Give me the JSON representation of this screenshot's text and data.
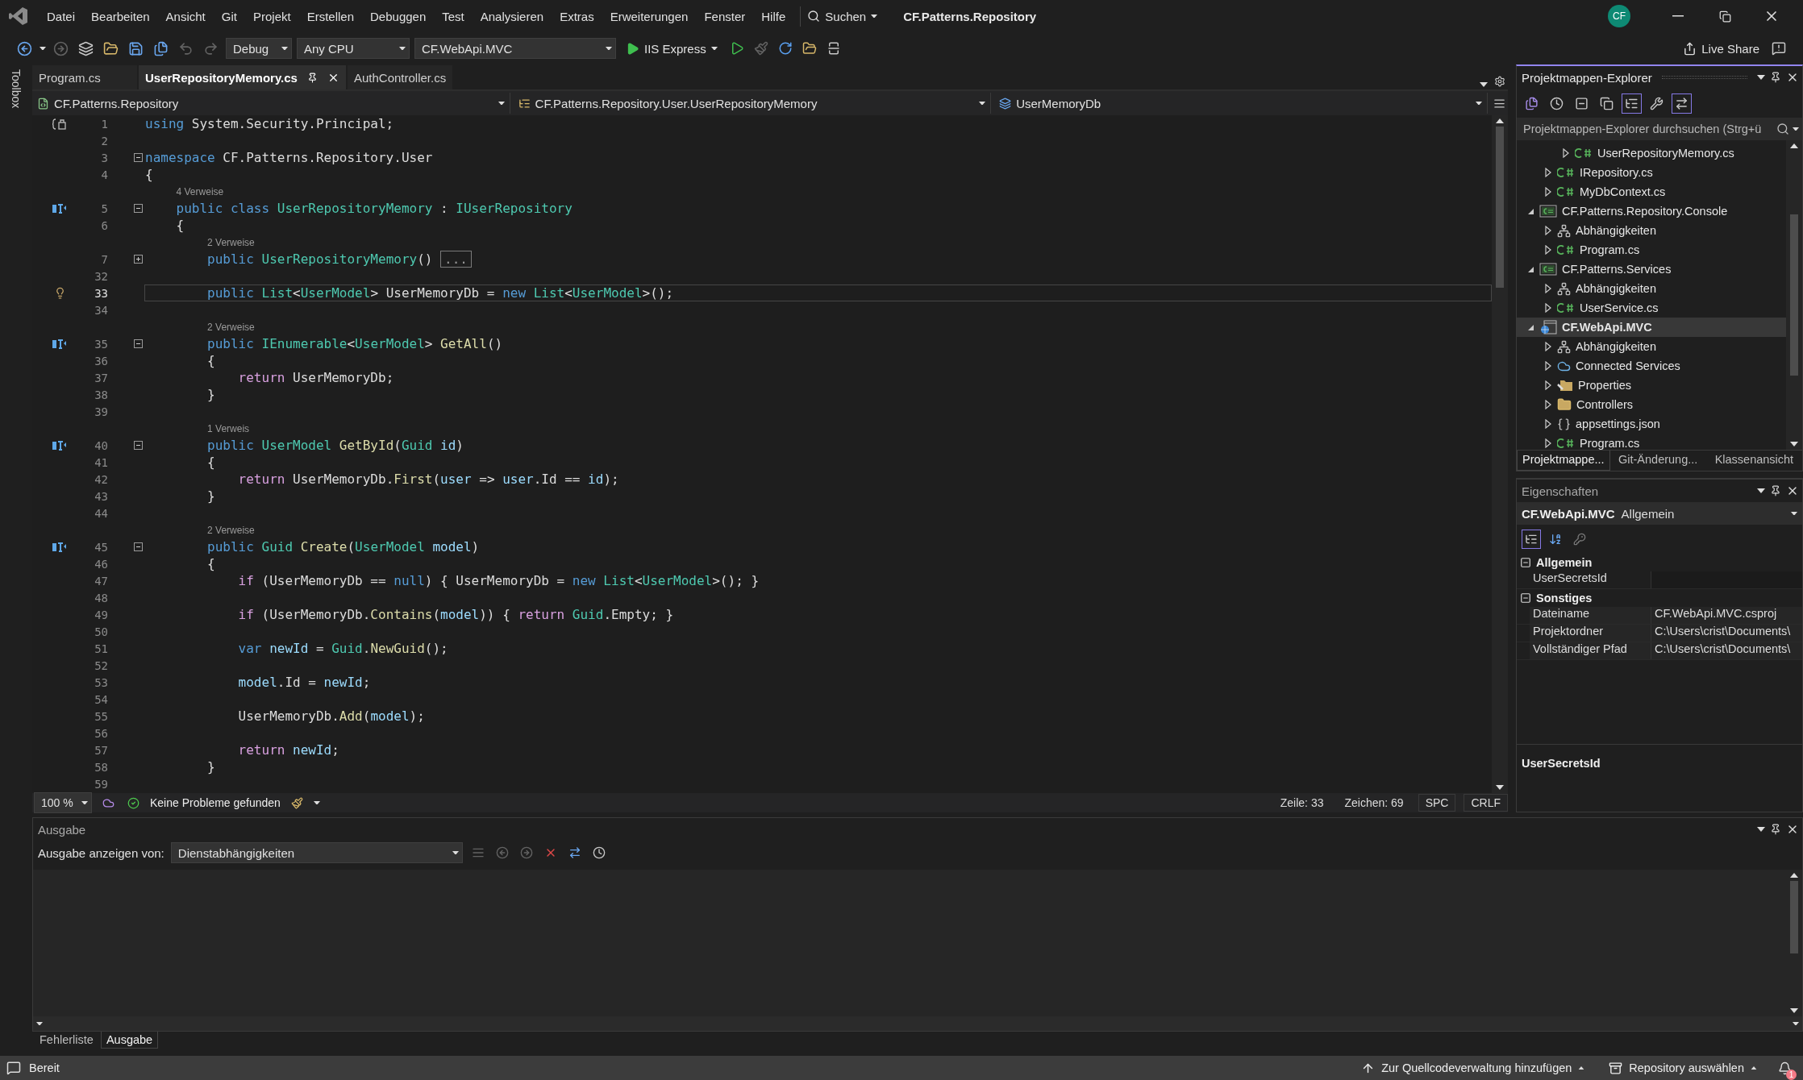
{
  "title_bar": {
    "menu": [
      "Datei",
      "Bearbeiten",
      "Ansicht",
      "Git",
      "Projekt",
      "Erstellen",
      "Debuggen",
      "Test",
      "Analysieren",
      "Extras",
      "Erweiterungen",
      "Fenster",
      "Hilfe"
    ],
    "search": "Suchen",
    "title": "CF.Patterns.Repository",
    "avatar": "CF"
  },
  "toolbar": {
    "dropdowns": [
      "Debug",
      "Any CPU",
      "CF.WebApi.MVC"
    ],
    "run": "IIS Express",
    "live_share": "Live Share"
  },
  "toolbox": "Toolbox",
  "editor": {
    "tabs": [
      {
        "label": "Program.cs",
        "selected": false
      },
      {
        "label": "UserRepositoryMemory.cs",
        "selected": true
      },
      {
        "label": "AuthController.cs",
        "selected": false
      }
    ],
    "nav": [
      "CF.Patterns.Repository",
      "CF.Patterns.Repository.User.UserRepositoryMemory",
      "UserMemoryDb"
    ],
    "lines": [
      {
        "number": "1",
        "bracket_marker": true,
        "segments": [
          {
            "kind": "keyword",
            "text": "using "
          },
          {
            "kind": "plain",
            "text": "System.Security.Principal;"
          }
        ]
      },
      {
        "number": "2"
      },
      {
        "number": "3",
        "collapsed": false,
        "segments": [
          {
            "kind": "keyword",
            "text": "namespace "
          },
          {
            "kind": "plain",
            "text": "CF.Patterns.Repository.User"
          }
        ]
      },
      {
        "number": "4",
        "segments": [
          {
            "kind": "plain",
            "text": "{"
          }
        ]
      },
      {
        "kind": "lens",
        "text": "4 Verweise"
      },
      {
        "number": "5",
        "implements": true,
        "collapsed": false,
        "segments": [
          {
            "kind": "keyword",
            "text": "    public class "
          },
          {
            "kind": "type",
            "text": "UserRepositoryMemory"
          },
          {
            "kind": "plain",
            "text": " : "
          },
          {
            "kind": "type",
            "text": "IUserRepository"
          }
        ]
      },
      {
        "number": "6",
        "segments": [
          {
            "kind": "plain",
            "text": "    {"
          }
        ]
      },
      {
        "kind": "lens",
        "text": "2 Verweise"
      },
      {
        "number": "7",
        "collapsed": true,
        "segments": [
          {
            "kind": "keyword",
            "text": "        public "
          },
          {
            "kind": "type",
            "text": "UserRepositoryMemory"
          },
          {
            "kind": "plain",
            "text": "() "
          },
          {
            "kind": "collapsed",
            "text": "..."
          }
        ]
      },
      {
        "number": "32"
      },
      {
        "number": "33",
        "lightbulb": true,
        "current": true,
        "segments": [
          {
            "kind": "keyword",
            "text": "        public "
          },
          {
            "kind": "type",
            "text": "List"
          },
          {
            "kind": "plain",
            "text": "<"
          },
          {
            "kind": "type",
            "text": "UserModel"
          },
          {
            "kind": "plain",
            "text": "> UserMemoryDb = "
          },
          {
            "kind": "keyword",
            "text": "new "
          },
          {
            "kind": "type",
            "text": "List"
          },
          {
            "kind": "plain",
            "text": "<"
          },
          {
            "kind": "type",
            "text": "UserModel"
          },
          {
            "kind": "plain",
            "text": ">();"
          }
        ]
      },
      {
        "number": "34"
      },
      {
        "kind": "lens",
        "text": "2 Verweise"
      },
      {
        "number": "35",
        "implements": true,
        "collapsed": false,
        "segments": [
          {
            "kind": "keyword",
            "text": "        public "
          },
          {
            "kind": "type",
            "text": "IEnumerable"
          },
          {
            "kind": "plain",
            "text": "<"
          },
          {
            "kind": "type",
            "text": "UserModel"
          },
          {
            "kind": "plain",
            "text": "> "
          },
          {
            "kind": "method",
            "text": "GetAll"
          },
          {
            "kind": "plain",
            "text": "()"
          }
        ]
      },
      {
        "number": "36",
        "segments": [
          {
            "kind": "plain",
            "text": "        {"
          }
        ]
      },
      {
        "number": "37",
        "segments": [
          {
            "kind": "control",
            "text": "            return "
          },
          {
            "kind": "plain",
            "text": "UserMemoryDb;"
          }
        ]
      },
      {
        "number": "38",
        "segments": [
          {
            "kind": "plain",
            "text": "        }"
          }
        ]
      },
      {
        "number": "39"
      },
      {
        "kind": "lens",
        "text": "1 Verweis"
      },
      {
        "number": "40",
        "implements": true,
        "collapsed": false,
        "segments": [
          {
            "kind": "keyword",
            "text": "        public "
          },
          {
            "kind": "type",
            "text": "UserModel "
          },
          {
            "kind": "method",
            "text": "GetById"
          },
          {
            "kind": "plain",
            "text": "("
          },
          {
            "kind": "type",
            "text": "Guid "
          },
          {
            "kind": "variable",
            "text": "id"
          },
          {
            "kind": "plain",
            "text": ")"
          }
        ]
      },
      {
        "number": "41",
        "segments": [
          {
            "kind": "plain",
            "text": "        {"
          }
        ]
      },
      {
        "number": "42",
        "segments": [
          {
            "kind": "control",
            "text": "            return "
          },
          {
            "kind": "plain",
            "text": "UserMemoryDb."
          },
          {
            "kind": "method",
            "text": "First"
          },
          {
            "kind": "plain",
            "text": "("
          },
          {
            "kind": "variable",
            "text": "user"
          },
          {
            "kind": "plain",
            "text": " => "
          },
          {
            "kind": "variable",
            "text": "user"
          },
          {
            "kind": "plain",
            "text": ".Id == "
          },
          {
            "kind": "variable",
            "text": "id"
          },
          {
            "kind": "plain",
            "text": ");"
          }
        ]
      },
      {
        "number": "43",
        "segments": [
          {
            "kind": "plain",
            "text": "        }"
          }
        ]
      },
      {
        "number": "44"
      },
      {
        "kind": "lens",
        "text": "2 Verweise"
      },
      {
        "number": "45",
        "implements": true,
        "collapsed": false,
        "segments": [
          {
            "kind": "keyword",
            "text": "        public "
          },
          {
            "kind": "type",
            "text": "Guid "
          },
          {
            "kind": "method",
            "text": "Create"
          },
          {
            "kind": "plain",
            "text": "("
          },
          {
            "kind": "type",
            "text": "UserModel "
          },
          {
            "kind": "variable",
            "text": "model"
          },
          {
            "kind": "plain",
            "text": ")"
          }
        ]
      },
      {
        "number": "46",
        "segments": [
          {
            "kind": "plain",
            "text": "        {"
          }
        ]
      },
      {
        "number": "47",
        "segments": [
          {
            "kind": "control",
            "text": "            if "
          },
          {
            "kind": "plain",
            "text": "(UserMemoryDb == "
          },
          {
            "kind": "keyword",
            "text": "null"
          },
          {
            "kind": "plain",
            "text": ") { UserMemoryDb = "
          },
          {
            "kind": "keyword",
            "text": "new "
          },
          {
            "kind": "type",
            "text": "List"
          },
          {
            "kind": "plain",
            "text": "<"
          },
          {
            "kind": "type",
            "text": "UserModel"
          },
          {
            "kind": "plain",
            "text": ">(); }"
          }
        ]
      },
      {
        "number": "48"
      },
      {
        "number": "49",
        "segments": [
          {
            "kind": "control",
            "text": "            if "
          },
          {
            "kind": "plain",
            "text": "(UserMemoryDb."
          },
          {
            "kind": "method",
            "text": "Contains"
          },
          {
            "kind": "plain",
            "text": "("
          },
          {
            "kind": "variable",
            "text": "model"
          },
          {
            "kind": "plain",
            "text": ")) { "
          },
          {
            "kind": "control",
            "text": "return "
          },
          {
            "kind": "type",
            "text": "Guid"
          },
          {
            "kind": "plain",
            "text": ".Empty; }"
          }
        ]
      },
      {
        "number": "50"
      },
      {
        "number": "51",
        "segments": [
          {
            "kind": "keyword",
            "text": "            var "
          },
          {
            "kind": "variable",
            "text": "newId"
          },
          {
            "kind": "plain",
            "text": " = "
          },
          {
            "kind": "type",
            "text": "Guid"
          },
          {
            "kind": "plain",
            "text": "."
          },
          {
            "kind": "method",
            "text": "NewGuid"
          },
          {
            "kind": "plain",
            "text": "();"
          }
        ]
      },
      {
        "number": "52"
      },
      {
        "number": "53",
        "segments": [
          {
            "kind": "variable",
            "text": "            model"
          },
          {
            "kind": "plain",
            "text": ".Id = "
          },
          {
            "kind": "variable",
            "text": "newId"
          },
          {
            "kind": "plain",
            "text": ";"
          }
        ]
      },
      {
        "number": "54"
      },
      {
        "number": "55",
        "segments": [
          {
            "kind": "plain",
            "text": "            UserMemoryDb."
          },
          {
            "kind": "method",
            "text": "Add"
          },
          {
            "kind": "plain",
            "text": "("
          },
          {
            "kind": "variable",
            "text": "model"
          },
          {
            "kind": "plain",
            "text": ");"
          }
        ]
      },
      {
        "number": "56"
      },
      {
        "number": "57",
        "segments": [
          {
            "kind": "control",
            "text": "            return "
          },
          {
            "kind": "variable",
            "text": "newId"
          },
          {
            "kind": "plain",
            "text": ";"
          }
        ]
      },
      {
        "number": "58",
        "segments": [
          {
            "kind": "plain",
            "text": "        }"
          }
        ]
      },
      {
        "number": "59"
      }
    ],
    "status": {
      "zoom": "100 %",
      "problems": "Keine Probleme gefunden",
      "line": "Zeile: 33",
      "column": "Zeichen: 69",
      "whitespace": "SPC",
      "line_ending": "CRLF"
    }
  },
  "solution_explorer": {
    "title": "Projektmappen-Explorer",
    "search": {
      "placeholder": "Projektmappen-Explorer durchsuchen (Strg+ü"
    },
    "tree": [
      {
        "children": [
          {
            "children": [
              {
                "label": "UserRepositoryMemory.cs",
                "kind": "csharp",
                "expanded": false,
                "selected": false
              }
            ]
          },
          {
            "label": "IRepository.cs",
            "kind": "csharp",
            "expanded": false,
            "selected": false
          },
          {
            "label": "MyDbContext.cs",
            "kind": "csharp",
            "expanded": false,
            "selected": false
          }
        ]
      },
      {
        "label": "CF.Patterns.Repository.Console",
        "kind": "project",
        "expanded": true,
        "selected": false,
        "children": [
          {
            "label": "Abhängigkeiten",
            "kind": "dependencies",
            "expanded": false,
            "selected": false
          },
          {
            "label": "Program.cs",
            "kind": "csharp",
            "expanded": false,
            "selected": false
          }
        ]
      },
      {
        "label": "CF.Patterns.Services",
        "kind": "project",
        "expanded": true,
        "selected": false,
        "children": [
          {
            "label": "Abhängigkeiten",
            "kind": "dependencies",
            "expanded": false,
            "selected": false
          },
          {
            "label": "UserService.cs",
            "kind": "csharp",
            "expanded": false,
            "selected": false
          }
        ]
      },
      {
        "label": "CF.WebApi.MVC",
        "kind": "web",
        "expanded": true,
        "selected": true,
        "startup": true,
        "children": [
          {
            "label": "Abhängigkeiten",
            "kind": "dependencies",
            "expanded": false,
            "selected": false
          },
          {
            "label": "Connected Services",
            "kind": "cloud",
            "expanded": false,
            "selected": false
          },
          {
            "label": "Properties",
            "kind": "properties",
            "expanded": false,
            "selected": false
          },
          {
            "label": "Controllers",
            "kind": "folder",
            "expanded": false,
            "selected": false
          },
          {
            "label": "appsettings.json",
            "kind": "json",
            "expanded": false,
            "selected": false
          },
          {
            "label": "Program.cs",
            "kind": "csharp",
            "expanded": false,
            "selected": false
          }
        ]
      }
    ],
    "tabs": [
      {
        "label": "Projektmappe...",
        "selected": true
      },
      {
        "label": "Git-Änderung...",
        "selected": false
      },
      {
        "label": "Klassenansicht",
        "selected": false
      }
    ]
  },
  "properties": {
    "title": "Eigenschaften",
    "object": "CF.WebApi.MVC",
    "object_type": "Allgemein",
    "categories": [
      {
        "name": "Allgemein",
        "expanded": true,
        "items": [
          {
            "name": "UserSecretsId",
            "selected": true
          }
        ]
      },
      {
        "name": "Sonstiges",
        "expanded": true,
        "items": [
          {
            "name": "Dateiname",
            "value": "CF.WebApi.MVC.csproj",
            "selected": false
          },
          {
            "name": "Projektordner",
            "value": "C:\\Users\\crist\\Documents\\",
            "selected": false
          },
          {
            "name": "Vollständiger Pfad",
            "value": "C:\\Users\\crist\\Documents\\",
            "selected": false
          }
        ]
      }
    ],
    "description": "UserSecretsId"
  },
  "output": {
    "title": "Ausgabe",
    "source_label": "Ausgabe anzeigen von:",
    "source": "Dienstabhängigkeiten"
  },
  "bottom_tabs": [
    {
      "label": "Fehlerliste",
      "selected": false
    },
    {
      "label": "Ausgabe",
      "selected": true
    }
  ],
  "status_bar": {
    "state": "Bereit",
    "source_control": "Zur Quellcodeverwaltung hinzufügen",
    "repository": "Repository auswählen",
    "notifications": "1"
  }
}
